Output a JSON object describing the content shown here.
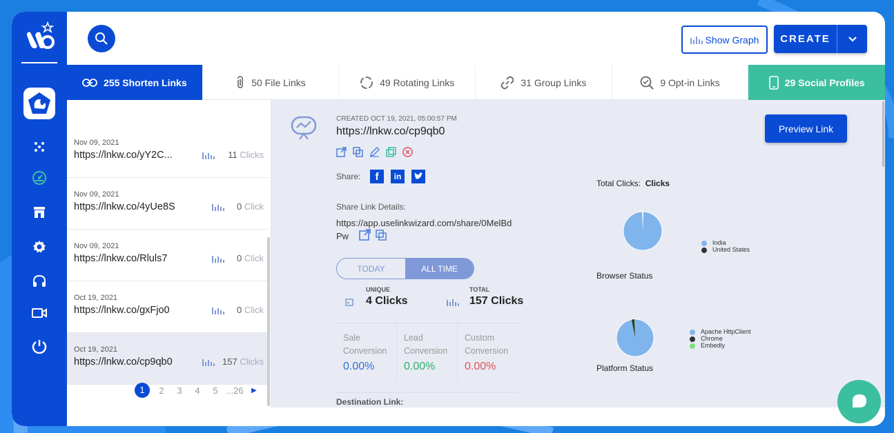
{
  "app": {
    "title": "LinkWizard",
    "accent": "#0a4bd6",
    "social_accent": "#3cbf9f"
  },
  "sidebar": {
    "items": [
      {
        "icon": "dots-icon"
      },
      {
        "icon": "dashboard-icon"
      },
      {
        "icon": "store-icon"
      },
      {
        "icon": "settings-icon"
      },
      {
        "icon": "headset-icon"
      },
      {
        "icon": "video-icon"
      },
      {
        "icon": "power-icon"
      }
    ]
  },
  "topbar": {
    "show_graph_label": "Show Graph",
    "create_label": "CREATE"
  },
  "tabs": [
    {
      "label": "255 Shorten Links",
      "icon": "link-icon"
    },
    {
      "label": "50 File Links",
      "icon": "paperclip-icon"
    },
    {
      "label": "49 Rotating Links",
      "icon": "rotate-icon"
    },
    {
      "label": "31 Group Links",
      "icon": "chain-icon"
    },
    {
      "label": "9 Opt-in Links",
      "icon": "search-check-icon"
    },
    {
      "label": "29 Social Profiles",
      "icon": "phone-icon"
    }
  ],
  "links": [
    {
      "date": "Nov 09, 2021",
      "url": "https://lnkw.co/yY2C...",
      "count": "11",
      "unit": "Clicks"
    },
    {
      "date": "Nov 09, 2021",
      "url": "https://lnkw.co/4yUe8S",
      "count": "0",
      "unit": "Click"
    },
    {
      "date": "Nov 09, 2021",
      "url": "https://lnkw.co/Rluls7",
      "count": "0",
      "unit": "Click"
    },
    {
      "date": "Oct 19, 2021",
      "url": "https://lnkw.co/gxFjo0",
      "count": "0",
      "unit": "Click"
    },
    {
      "date": "Oct 19, 2021",
      "url": "https://lnkw.co/cp9qb0",
      "count": "157",
      "unit": "Clicks"
    }
  ],
  "pager": {
    "current": "1",
    "pages": [
      "2",
      "3",
      "4",
      "5",
      "...26"
    ]
  },
  "detail": {
    "created": "CREATED OCT 19, 2021, 05:00:57 PM",
    "url": "https://lnkw.co/cp9qb0",
    "share_label": "Share:",
    "share_details_label": "Share Link Details:",
    "share_link_line1": "https://app.uselinkwizard.com/share/0MelBd",
    "share_link_line2": "Pw",
    "preview_label": "Preview Link",
    "toggle_today": "TODAY",
    "toggle_all": "ALL TIME",
    "unique_label": "UNIQUE",
    "unique_value": "4 Clicks",
    "total_label": "TOTAL",
    "total_value": "157 Clicks",
    "conversions": [
      {
        "line1": "Sale",
        "line2": "Conversion",
        "value": "0.00%",
        "color": "#2f6fd6"
      },
      {
        "line1": "Lead",
        "line2": "Conversion",
        "value": "0.00%",
        "color": "#2eaf6a"
      },
      {
        "line1": "Custom",
        "line2": "Conversion",
        "value": "0.00%",
        "color": "#e0505a"
      }
    ],
    "destination_label": "Destination Link:"
  },
  "stats": {
    "total_clicks_label": "Total Clicks:",
    "total_clicks_value": "Clicks",
    "browser_label": "Browser Status",
    "platform_label": "Platform Status",
    "country_legend": [
      "India",
      "United States"
    ],
    "browser_legend": [
      "Apache HttpClient",
      "Chrome",
      "Embedly"
    ]
  }
}
